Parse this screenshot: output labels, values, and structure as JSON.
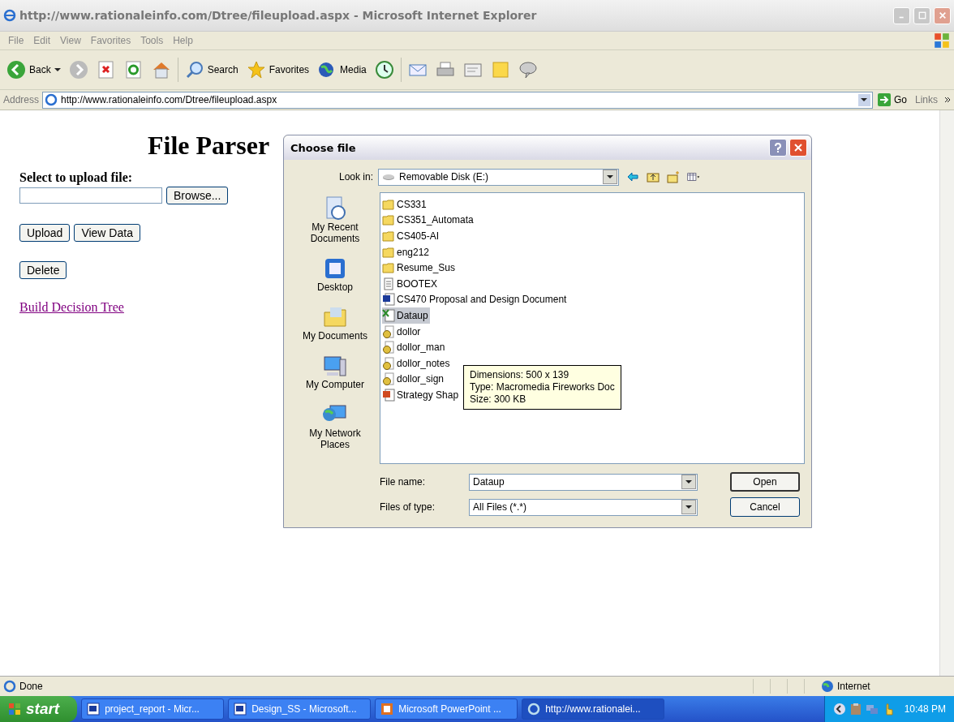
{
  "window": {
    "title": "http://www.rationaleinfo.com/Dtree/fileupload.aspx - Microsoft Internet Explorer"
  },
  "menu": [
    "File",
    "Edit",
    "View",
    "Favorites",
    "Tools",
    "Help"
  ],
  "toolbar": {
    "back": "Back",
    "search": "Search",
    "favorites": "Favorites",
    "media": "Media"
  },
  "address_bar": {
    "label": "Address",
    "value": "http://www.rationaleinfo.com/Dtree/fileupload.aspx",
    "go": "Go",
    "links": "Links"
  },
  "page": {
    "heading": "File Parser",
    "upload_label": "Select to upload file:",
    "browse": "Browse...",
    "buttons": [
      "Upload",
      "View Data"
    ],
    "delete": "Delete",
    "link": "Build Decision Tree"
  },
  "dialog": {
    "title": "Choose file",
    "look_in_label": "Look in:",
    "look_in": "Removable Disk (E:)",
    "places": [
      {
        "label": "My Recent Documents",
        "kind": "recent"
      },
      {
        "label": "Desktop",
        "kind": "desktop"
      },
      {
        "label": "My Documents",
        "kind": "documents"
      },
      {
        "label": "My Computer",
        "kind": "computer"
      },
      {
        "label": "My Network Places",
        "kind": "network"
      }
    ],
    "files": [
      {
        "name": "CS331",
        "kind": "folder",
        "selected": false
      },
      {
        "name": "CS351_Automata",
        "kind": "folder",
        "selected": false
      },
      {
        "name": "CS405-AI",
        "kind": "folder",
        "selected": false
      },
      {
        "name": "eng212",
        "kind": "folder",
        "selected": false
      },
      {
        "name": "Resume_Sus",
        "kind": "folder",
        "selected": false
      },
      {
        "name": "BOOTEX",
        "kind": "text",
        "selected": false
      },
      {
        "name": "CS470 Proposal and Design Document",
        "kind": "word",
        "selected": false
      },
      {
        "name": "Dataup",
        "kind": "excel",
        "selected": true
      },
      {
        "name": "dollor",
        "kind": "fireworks",
        "selected": false
      },
      {
        "name": "dollor_man",
        "kind": "fireworks",
        "selected": false
      },
      {
        "name": "dollor_notes",
        "kind": "fireworks",
        "selected": false
      },
      {
        "name": "dollor_sign",
        "kind": "fireworks",
        "selected": false
      },
      {
        "name": "Strategy Shap",
        "kind": "powerpoint",
        "selected": false
      }
    ],
    "tooltip": [
      "Dimensions: 500 x 139",
      "Type: Macromedia Fireworks Doc",
      "Size: 300 KB"
    ],
    "file_name_label": "File name:",
    "file_name": "Dataup",
    "file_type_label": "Files of type:",
    "file_type": "All Files (*.*)",
    "open": "Open",
    "cancel": "Cancel"
  },
  "status_bar": {
    "text": "Done",
    "zone": "Internet"
  },
  "taskbar": {
    "start": "start",
    "items": [
      {
        "label": "project_report - Micr...",
        "kind": "word",
        "selected": false
      },
      {
        "label": "Design_SS - Microsoft...",
        "kind": "word",
        "selected": false
      },
      {
        "label": "Microsoft PowerPoint ...",
        "kind": "powerpoint",
        "selected": false
      },
      {
        "label": "http://www.rationalei...",
        "kind": "ie",
        "selected": true
      }
    ],
    "clock": "10:48 PM"
  }
}
